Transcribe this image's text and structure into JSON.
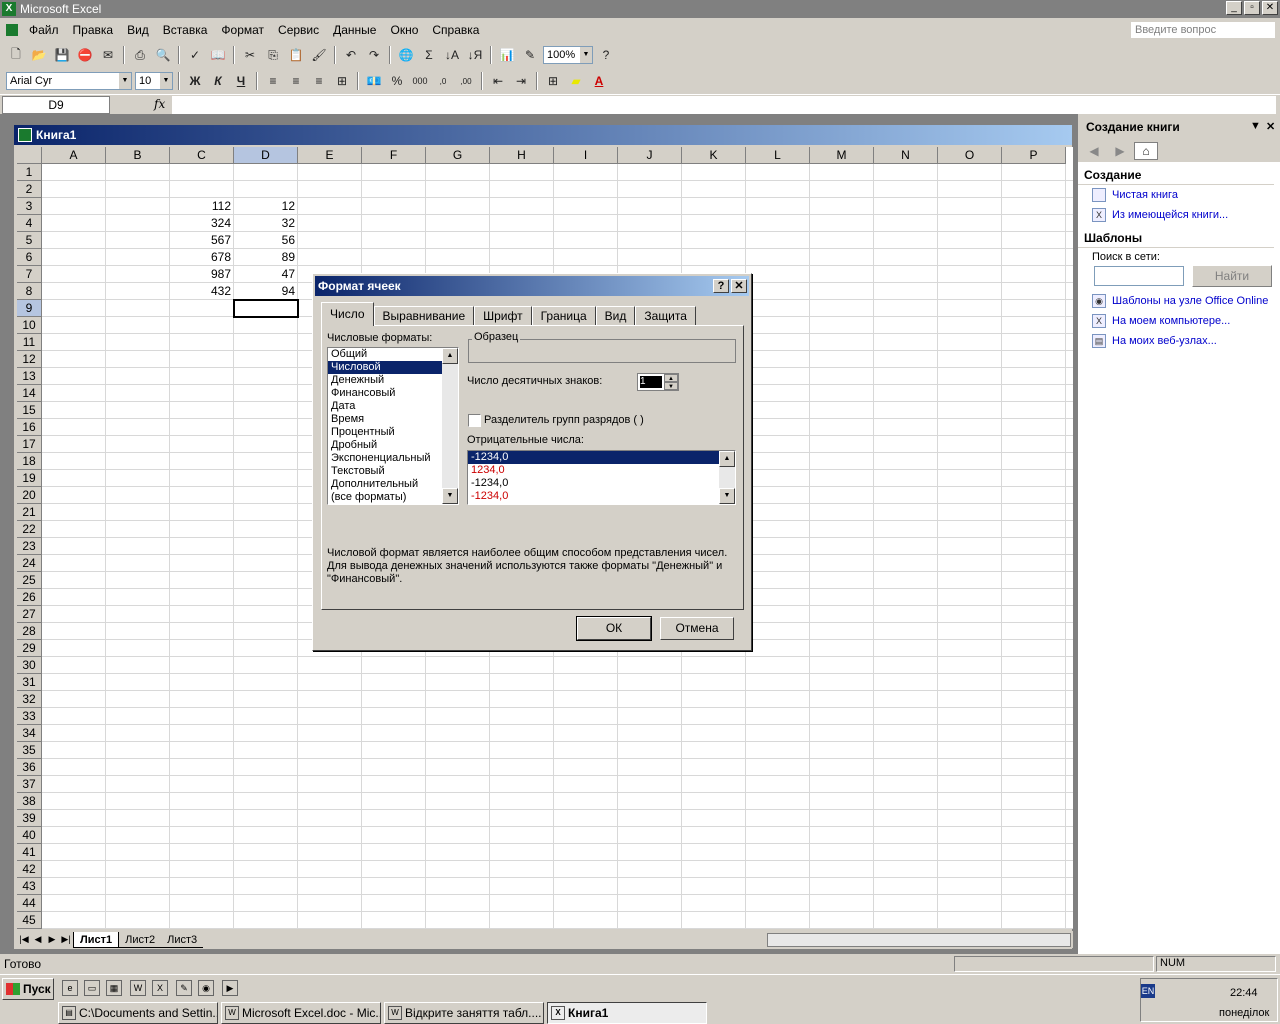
{
  "app": {
    "title": "Microsoft Excel"
  },
  "menu": [
    "Файл",
    "Правка",
    "Вид",
    "Вставка",
    "Формат",
    "Сервис",
    "Данные",
    "Окно",
    "Справка"
  ],
  "help_placeholder": "Введите вопрос",
  "toolbar": {
    "zoom": "100%",
    "font": "Arial Cyr",
    "font_size": "10",
    "bold": "Ж",
    "italic": "К",
    "underline": "Ч"
  },
  "formula": {
    "namebox": "D9",
    "fx": "fx"
  },
  "workbook": {
    "title": "Книга1",
    "columns": [
      "A",
      "B",
      "C",
      "D",
      "E",
      "F",
      "G",
      "H",
      "I",
      "J",
      "K",
      "L",
      "M",
      "N",
      "O",
      "P"
    ],
    "rows": [
      "1",
      "2",
      "3",
      "4",
      "5",
      "6",
      "7",
      "8",
      "9",
      "10",
      "11",
      "12",
      "13",
      "14",
      "15",
      "16",
      "17",
      "18",
      "19",
      "20",
      "21",
      "22",
      "23",
      "24",
      "25",
      "26",
      "27",
      "28",
      "29",
      "30",
      "31",
      "32",
      "33",
      "34",
      "35",
      "36",
      "37",
      "38",
      "39",
      "40",
      "41",
      "42",
      "43",
      "44",
      "45"
    ],
    "cells_c": [
      "112",
      "324",
      "567",
      "678",
      "987",
      "432"
    ],
    "cells_d": [
      "12",
      "32",
      "56",
      "89",
      "47",
      "94"
    ],
    "sheets": [
      "Лист1",
      "Лист2",
      "Лист3"
    ]
  },
  "taskpane": {
    "title": "Создание книги",
    "section_create": "Создание",
    "link_blank": "Чистая книга",
    "link_existing": "Из имеющейся книги...",
    "section_templates": "Шаблоны",
    "search_label": "Поиск в сети:",
    "find_button": "Найти",
    "link_office_online": "Шаблоны на узле Office Online",
    "link_my_computer": "На моем компьютере...",
    "link_web": "На моих веб-узлах..."
  },
  "status": {
    "ready": "Готово",
    "num": "NUM"
  },
  "dialog": {
    "title": "Формат ячеек",
    "help": "?",
    "close": "✕",
    "tabs": [
      "Число",
      "Выравнивание",
      "Шрифт",
      "Граница",
      "Вид",
      "Защита"
    ],
    "formats_label": "Числовые форматы:",
    "formats": [
      "Общий",
      "Числовой",
      "Денежный",
      "Финансовый",
      "Дата",
      "Время",
      "Процентный",
      "Дробный",
      "Экспоненциальный",
      "Текстовый",
      "Дополнительный",
      "(все форматы)"
    ],
    "sample_label": "Образец",
    "decimals_label": "Число десятичных знаков:",
    "decimals_value": "1",
    "separator_label": "Разделитель групп разрядов ( )",
    "negative_label": "Отрицательные числа:",
    "negatives": [
      "-1234,0",
      "1234,0",
      "-1234,0",
      "-1234,0"
    ],
    "description": "Числовой формат является наиболее общим способом представления чисел. Для вывода денежных значений используются также форматы \"Денежный\" и \"Финансовый\".",
    "ok": "ОК",
    "cancel": "Отмена"
  },
  "taskbar": {
    "start": "Пуск",
    "items": [
      "C:\\Documents and Settin...",
      "Microsoft Excel.doc - Mic...",
      "Відкрите заняття табл....",
      "Книга1"
    ],
    "lang": "EN",
    "time": "22:44",
    "day": "понеділок"
  }
}
